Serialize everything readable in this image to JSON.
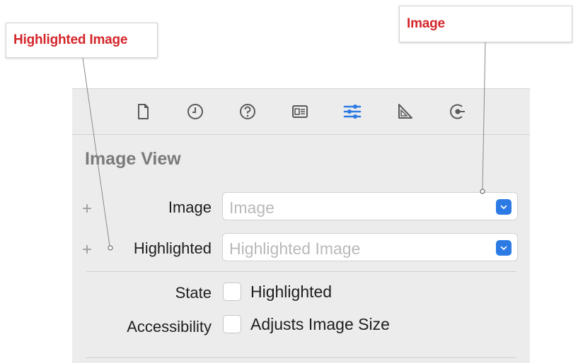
{
  "callouts": {
    "image": "Image",
    "highlighted_image": "Highlighted Image"
  },
  "toolbar": {
    "icons": [
      "file-icon",
      "history-icon",
      "help-icon",
      "identity-icon",
      "attributes-icon",
      "size-icon",
      "connections-icon"
    ],
    "active_color": "#2c7be5"
  },
  "section": {
    "title": "Image View"
  },
  "fields": {
    "image": {
      "label": "Image",
      "placeholder": "Image"
    },
    "highlighted": {
      "label": "Highlighted",
      "placeholder": "Highlighted Image"
    }
  },
  "state": {
    "label": "State",
    "checkbox_label": "Highlighted"
  },
  "accessibility": {
    "label": "Accessibility",
    "checkbox_label": "Adjusts Image Size"
  }
}
